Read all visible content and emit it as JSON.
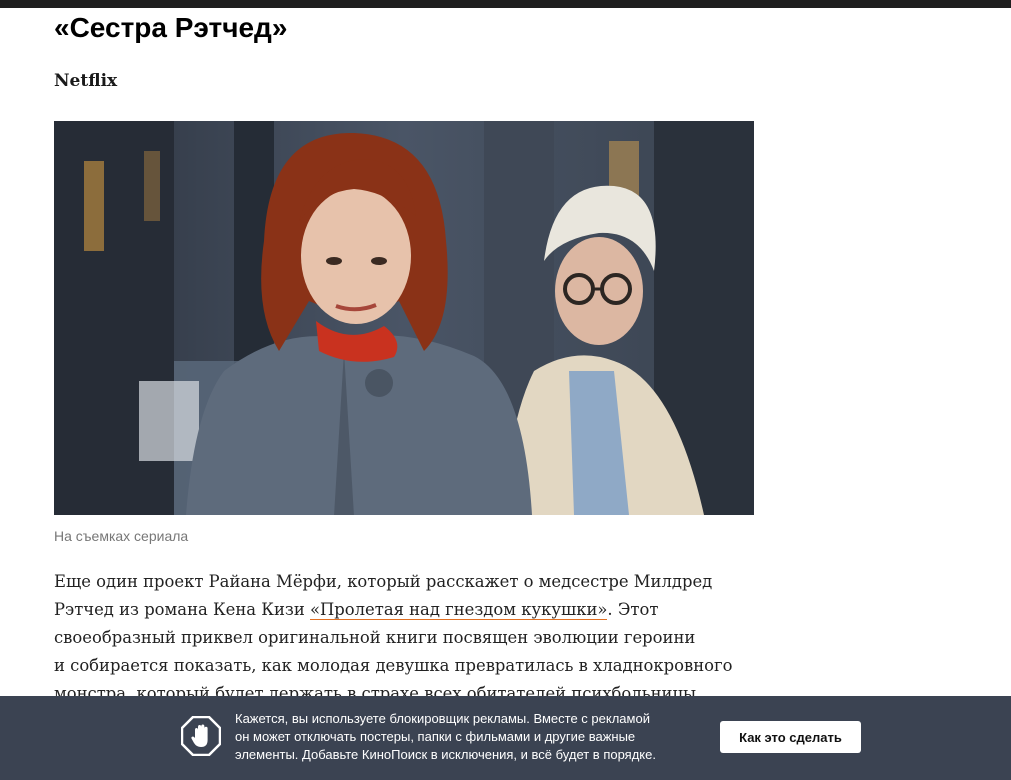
{
  "article": {
    "title": "«Сестра Рэтчед»",
    "subtitle": "Netflix",
    "photo_alt": "Сара Полсон на съемках сериала",
    "caption": "На съемках сериала",
    "paragraph": {
      "line1": "Еще один проект Райана Мёрфи, который расскажет о медсестре Милдред",
      "line2_before": "Рэтчед из романа Кена Кизи ",
      "line2_link": "«Пролетая над гнездом кукушки»",
      "line2_after": ". Этот",
      "line3": "своеобразный приквел оригинальной книги посвящен эволюции героини",
      "line4": "и собирается показать, как молодая девушка превратилась в хладнокровного",
      "line5": "монстра, который будет держать в страхе всех обитателей психбольницы."
    }
  },
  "adblock_notice": {
    "icon": "stop-hand-icon",
    "line1": "Кажется, вы используете блокировщик рекламы. Вместе с рекламой",
    "line2": "он может отключать постеры, папки с фильмами и другие важные",
    "line3": "элементы. Добавьте КиноПоиск в исключения, и всё будет в порядке.",
    "button_label": "Как это сделать"
  },
  "colors": {
    "top_strip": "#1f1f1f",
    "adblock_background": "#3b4352",
    "link_underline": "#e06f22",
    "caption_text": "#777777"
  }
}
